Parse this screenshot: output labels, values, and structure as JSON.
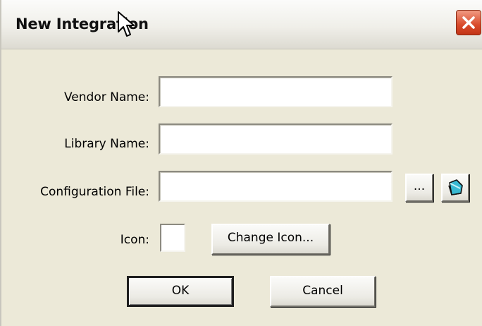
{
  "window": {
    "title": "New Integration"
  },
  "form": {
    "vendor_label": "Vendor Name:",
    "vendor_value": "",
    "library_label": "Library Name:",
    "library_value": "",
    "config_label": "Configuration File:",
    "config_value": "",
    "browse_label": "...",
    "icon_label": "Icon:",
    "change_icon_label": "Change Icon..."
  },
  "actions": {
    "ok_label": "OK",
    "cancel_label": "Cancel"
  },
  "icons": {
    "close": "close-icon",
    "edit": "edit-file-icon",
    "cursor": "mouse-pointer-icon"
  },
  "colors": {
    "window_bg": "#ece9d8",
    "close_red": "#d94a2b",
    "edit_icon": "#38b8d2"
  }
}
